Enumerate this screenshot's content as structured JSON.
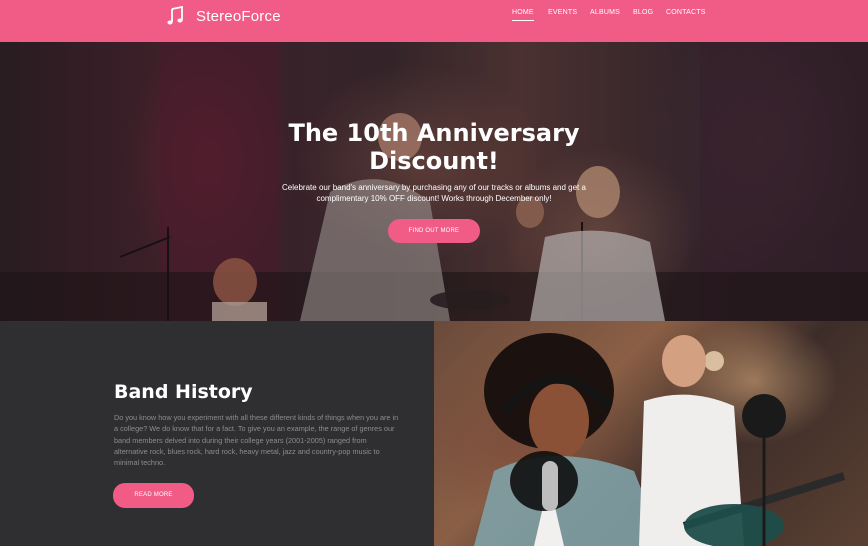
{
  "header": {
    "brand": "StereoForce",
    "logo_icon": "music-note-icon",
    "accent_color": "#f15c86",
    "nav": [
      {
        "label": "HOME",
        "active": true
      },
      {
        "label": "EVENTS",
        "active": false
      },
      {
        "label": "ALBUMS",
        "active": false
      },
      {
        "label": "BLOG",
        "active": false
      },
      {
        "label": "CONTACTS",
        "active": false
      }
    ]
  },
  "hero": {
    "title_line1": "The 10th Anniversary",
    "title_line2": "Discount!",
    "text_line1": "Celebrate our band's anniversary by purchasing any of our tracks or albums and get a",
    "text_line2": "complimentary 10% OFF discount! Works through December only!",
    "button_label": "FIND OUT MORE"
  },
  "history": {
    "title": "Band History",
    "paragraph": "Do you know how you experiment with all these different kinds of things when you are in a college? We do know that for a fact. To give you an example, the range of genres our band members delved into during their college years (2001-2005) ranged from alternative rock, blues rock, hard rock, heavy metal, jazz and country-pop music to minimal techno.",
    "button_label": "READ MORE"
  }
}
